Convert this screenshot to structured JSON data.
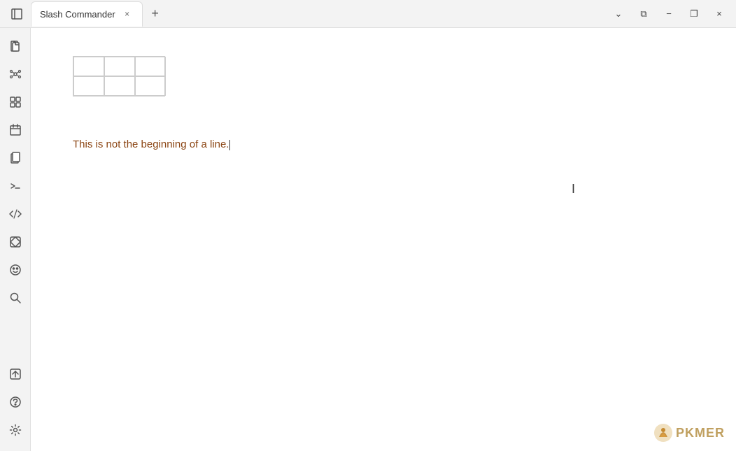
{
  "titlebar": {
    "tab_title": "Slash Commander",
    "tab_close_label": "×",
    "tab_new_label": "+",
    "ctrl_dropdown": "⌄",
    "ctrl_split": "⧉",
    "ctrl_minimize": "−",
    "ctrl_restore": "❐",
    "ctrl_close": "×"
  },
  "sidebar": {
    "items": [
      {
        "name": "sidebar-item-files",
        "icon": "files",
        "unicode": "🗋"
      },
      {
        "name": "sidebar-item-graph",
        "icon": "graph",
        "unicode": "⑂"
      },
      {
        "name": "sidebar-item-extensions",
        "icon": "extensions",
        "unicode": "⊞"
      },
      {
        "name": "sidebar-item-calendar",
        "icon": "calendar",
        "unicode": "⊡"
      },
      {
        "name": "sidebar-item-pages",
        "icon": "pages",
        "unicode": "⧉"
      },
      {
        "name": "sidebar-item-terminal",
        "icon": "terminal",
        "unicode": "⌨"
      },
      {
        "name": "sidebar-item-code",
        "icon": "code",
        "unicode": "⟨/⟩"
      },
      {
        "name": "sidebar-item-widget",
        "icon": "widget",
        "unicode": "⊕"
      },
      {
        "name": "sidebar-item-emoji",
        "icon": "emoji",
        "unicode": "☺"
      },
      {
        "name": "sidebar-item-search",
        "icon": "search",
        "unicode": "⌕"
      }
    ],
    "bottom_items": [
      {
        "name": "sidebar-item-publish",
        "icon": "publish",
        "unicode": "⊡"
      },
      {
        "name": "sidebar-item-help",
        "icon": "help",
        "unicode": "?"
      },
      {
        "name": "sidebar-item-settings",
        "icon": "settings",
        "unicode": "⚙"
      }
    ]
  },
  "content": {
    "text": "This is not the beginning of a line."
  },
  "pkmer": {
    "text": "PKMER"
  }
}
